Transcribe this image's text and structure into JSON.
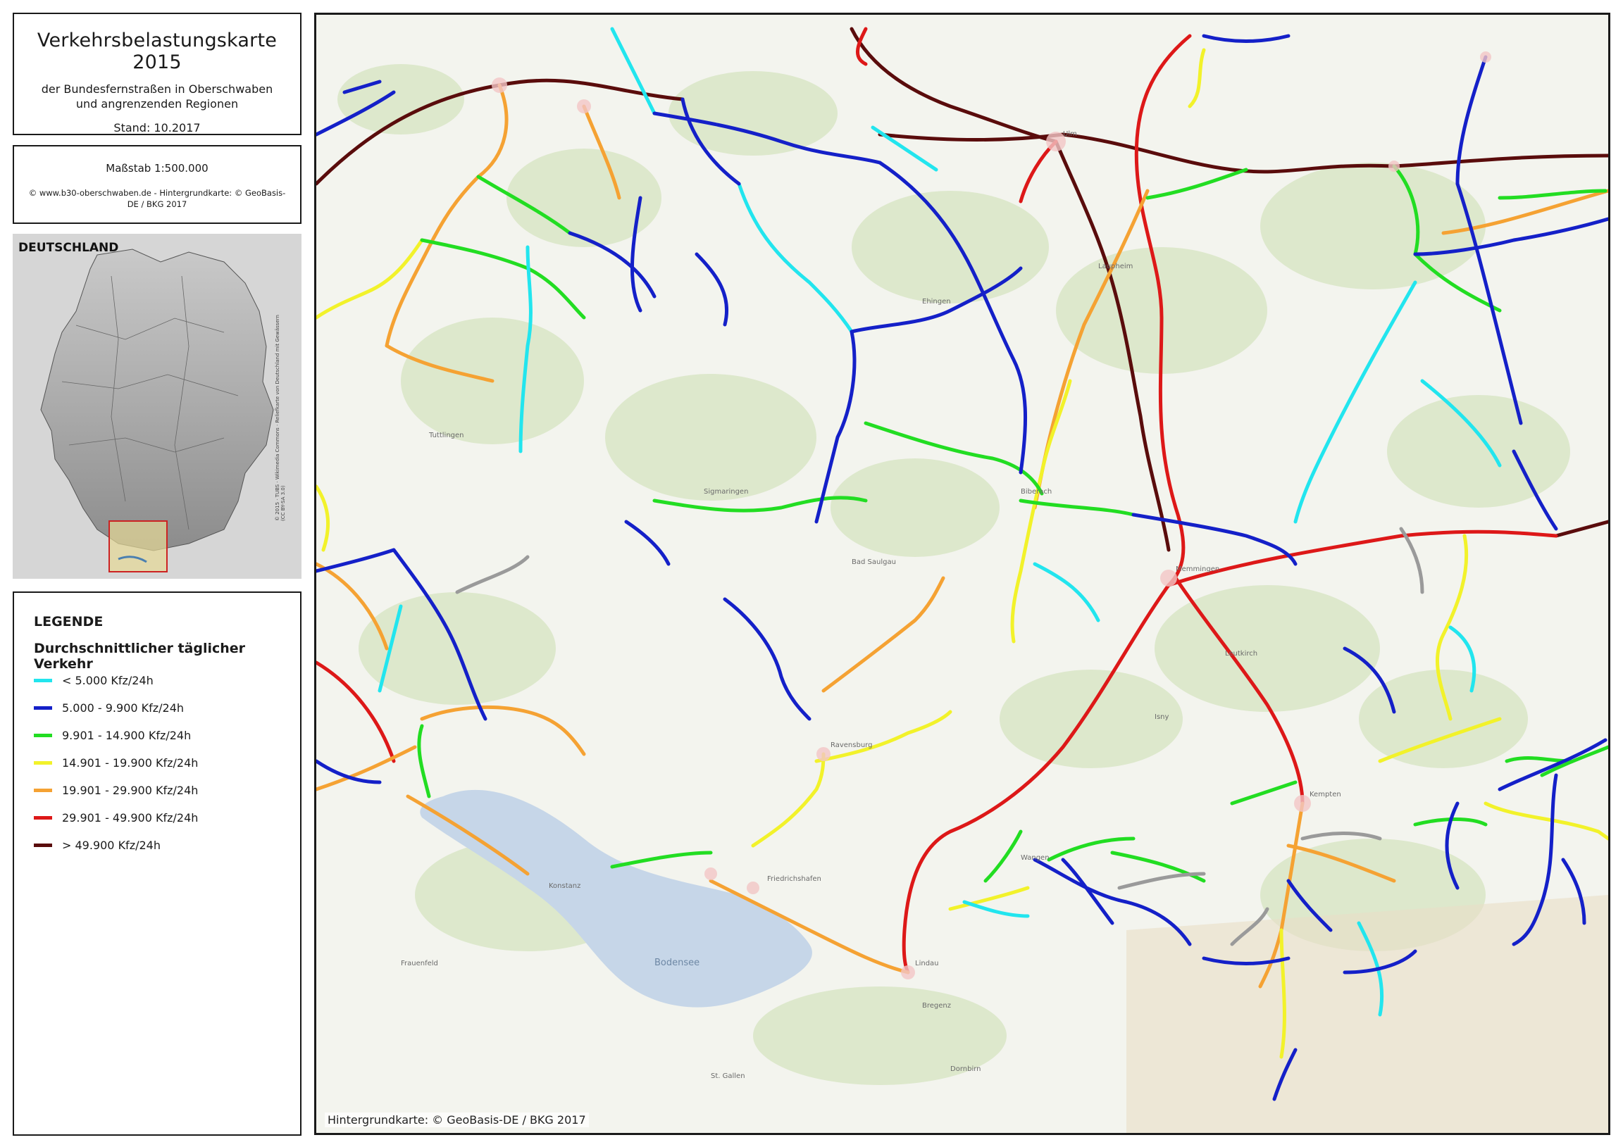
{
  "title": {
    "main": "Verkehrsbelastungskarte 2015",
    "line1": "der Bundesfernstraßen in Oberschwaben",
    "line2": "und angrenzenden Regionen",
    "stand": "Stand: 10.2017"
  },
  "scale": {
    "label": "Maßstab   1:500.000",
    "credit_line1": "© www.b30-oberschwaben.de - Hintergrundkarte: © GeoBasis-",
    "credit_line2": "DE / BKG 2017"
  },
  "overview": {
    "title": "DEUTSCHLAND",
    "credit": "© 2015 · TUBS · Wikimedia Commons · Reliefkarte von Deutschland mit Gewässern (CC BY-SA 3.0)"
  },
  "legend": {
    "title": "LEGENDE",
    "subtitle": "Durchschnittlicher täglicher Verkehr",
    "items": [
      {
        "label": "<  5.000 Kfz/24h",
        "color": "#22e5ee"
      },
      {
        "label": "   5.000 -   9.900 Kfz/24h",
        "color": "#1420c8"
      },
      {
        "label": "   9.901 - 14.900 Kfz/24h",
        "color": "#22dd22"
      },
      {
        "label": "  14.901 - 19.900 Kfz/24h",
        "color": "#f2f22a"
      },
      {
        "label": "  19.901 - 29.900 Kfz/24h",
        "color": "#f5a233"
      },
      {
        "label": "  29.901 - 49.900 Kfz/24h",
        "color": "#dd1818"
      },
      {
        "label": "> 49.900 Kfz/24h",
        "color": "#5a0c0c"
      }
    ]
  },
  "map": {
    "credit": "Hintergrundkarte: © GeoBasis-DE / BKG 2017",
    "lake_label": "Bodensee",
    "places": [
      "Ulm",
      "Biberach",
      "Ravensburg",
      "Friedrichshafen",
      "Lindau",
      "Memmingen",
      "Kempten",
      "Konstanz",
      "Sigmaringen",
      "Bregenz",
      "St. Gallen",
      "Wangen",
      "Leutkirch",
      "Bad Saulgau",
      "Tuttlingen",
      "Frauenfeld",
      "Ehingen",
      "Isny",
      "Laupheim",
      "Dornbirn"
    ]
  },
  "colors": {
    "lt5000": "#22e5ee",
    "c5000": "#1420c8",
    "c9901": "#22dd22",
    "c14901": "#f2f22a",
    "c19901": "#f5a233",
    "c29901": "#dd1818",
    "gt49900": "#5a0c0c",
    "lake": "#c6d6e8",
    "forest": "#dfe8cf"
  }
}
